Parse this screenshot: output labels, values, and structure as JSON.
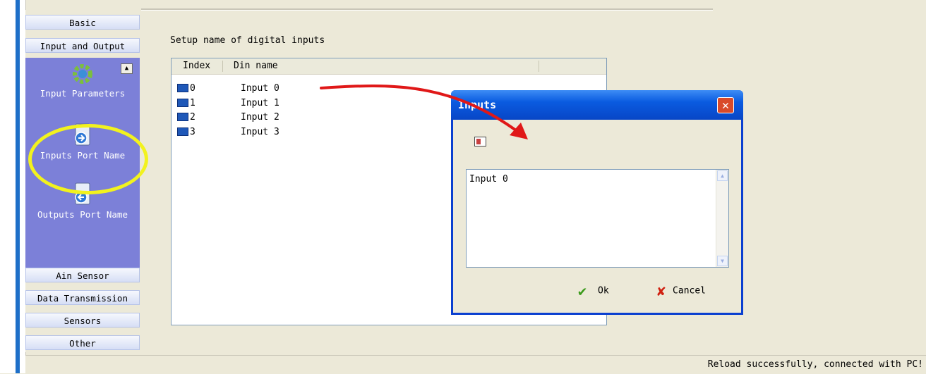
{
  "sidebar": {
    "headers": [
      "Basic",
      "Input and Output",
      "Ain Sensor",
      "Data Transmission",
      "Sensors",
      "Other"
    ],
    "items": [
      {
        "label": "Input Parameters",
        "icon": "gear-icon"
      },
      {
        "label": "Inputs Port Name",
        "icon": "input-port-icon"
      },
      {
        "label": "Outputs Port Name",
        "icon": "output-port-icon"
      }
    ],
    "scroll_up_glyph": "▲"
  },
  "main": {
    "title": "Setup name of digital inputs",
    "columns": [
      "Index",
      "Din name"
    ],
    "rows": [
      {
        "index": "0",
        "name": "Input 0"
      },
      {
        "index": "1",
        "name": "Input 1"
      },
      {
        "index": "2",
        "name": "Input 2"
      },
      {
        "index": "3",
        "name": "Input 3"
      }
    ]
  },
  "dialog": {
    "title": "Inputs",
    "close_glyph": "✕",
    "memo_value": "Input 0",
    "ok_label": "Ok",
    "cancel_label": "Cancel",
    "ok_glyph": "✔",
    "cancel_glyph": "✘"
  },
  "status": {
    "text": "Reload successfully, connected with PC!"
  },
  "colors": {
    "sidebar_panel": "#7c80d8",
    "dialog_title": "#0a5be0",
    "annotation_arrow": "#e01818",
    "highlight_ring": "#f2f21e"
  }
}
